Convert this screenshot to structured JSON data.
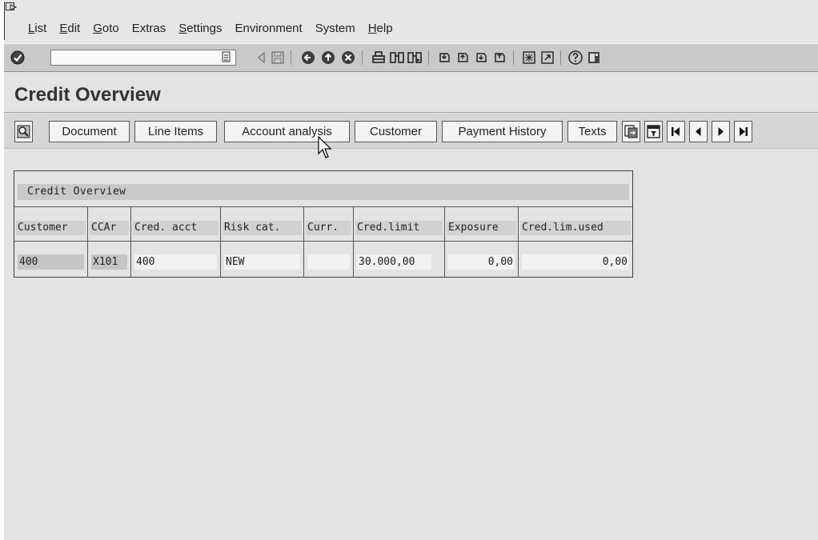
{
  "menu": {
    "items": [
      "List",
      "Edit",
      "Goto",
      "Extras",
      "Settings",
      "Environment",
      "System",
      "Help"
    ]
  },
  "toolbar": {
    "command_field_value": "",
    "icons": [
      "enter-icon",
      "back-icon",
      "save-icon",
      "green-arrow-back-icon",
      "exit-icon",
      "cancel-icon",
      "print-icon",
      "find-icon",
      "find-next-icon",
      "first-page-icon",
      "previous-page-icon",
      "next-page-icon",
      "last-page-icon",
      "create-session-icon",
      "shortcut-icon",
      "help-icon",
      "customize-layout-icon"
    ]
  },
  "page_title": "Credit Overview",
  "app_toolbar": {
    "buttons": [
      "Document",
      "Line Items",
      "Account analysis",
      "Customer",
      "Payment History",
      "Texts"
    ]
  },
  "list": {
    "title": "Credit Overview",
    "columns": [
      "Customer",
      "CCAr",
      "Cred. acct",
      "Risk cat.",
      "Curr.",
      "Cred.limit",
      "Exposure",
      "Cred.lim.used"
    ],
    "rows": [
      [
        "400",
        "X101",
        "400",
        "NEW",
        "",
        "30.000,00",
        "0,00",
        "0,00"
      ]
    ]
  }
}
